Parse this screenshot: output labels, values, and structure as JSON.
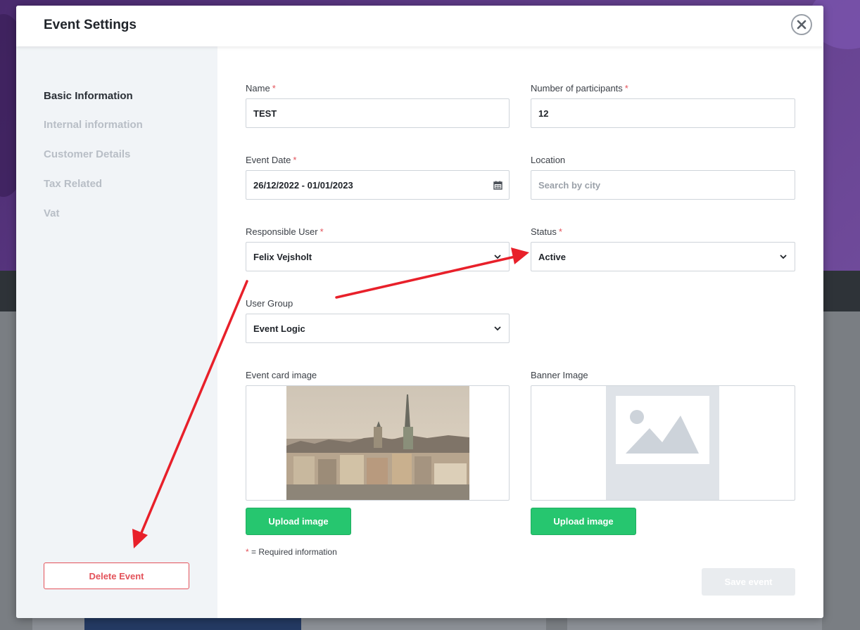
{
  "modal": {
    "title": "Event Settings"
  },
  "sidebar": {
    "items": [
      {
        "label": "Basic Information",
        "active": true
      },
      {
        "label": "Internal information",
        "active": false
      },
      {
        "label": "Customer Details",
        "active": false
      },
      {
        "label": "Tax Related",
        "active": false
      },
      {
        "label": "Vat",
        "active": false
      }
    ],
    "delete_label": "Delete Event"
  },
  "form": {
    "name": {
      "label": "Name",
      "required": "*",
      "value": "TEST"
    },
    "participants": {
      "label": "Number of participants",
      "required": "*",
      "value": "12"
    },
    "event_date": {
      "label": "Event Date",
      "required": "*",
      "value": "26/12/2022 - 01/01/2023"
    },
    "location": {
      "label": "Location",
      "placeholder": "Search by city"
    },
    "responsible_user": {
      "label": "Responsible User",
      "required": "*",
      "value": "Felix Vejsholt"
    },
    "status": {
      "label": "Status",
      "required": "*",
      "value": "Active"
    },
    "user_group": {
      "label": "User Group",
      "value": "Event Logic"
    },
    "event_card_image": {
      "label": "Event card image",
      "upload_label": "Upload image"
    },
    "banner_image": {
      "label": "Banner Image",
      "upload_label": "Upload image"
    },
    "required_note_mark": "*",
    "required_note_text": " = Required information",
    "save_label": "Save event"
  },
  "colors": {
    "accent_green": "#26c66f",
    "danger_red": "#e3525a",
    "annotation_red": "#e8202a",
    "sidebar_bg": "#f1f4f7"
  },
  "icons": [
    "close-icon",
    "calendar-icon",
    "chevron-down-icon",
    "image-placeholder-icon"
  ]
}
